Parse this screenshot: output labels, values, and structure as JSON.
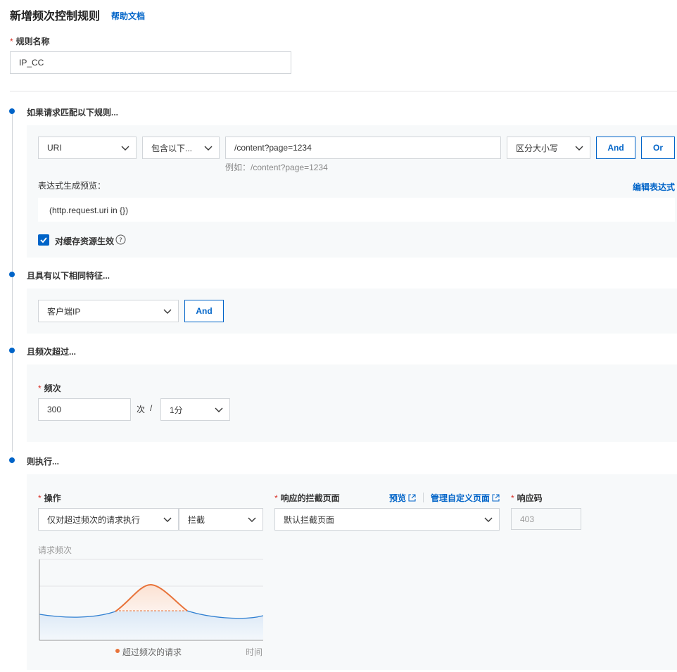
{
  "header": {
    "title": "新增频次控制规则",
    "help_link": "帮助文档"
  },
  "rule_name": {
    "label": "规则名称",
    "value": "IP_CC"
  },
  "match_section": {
    "title": "如果请求匹配以下规则...",
    "field": "URI",
    "operator": "包含以下...",
    "value": "/content?page=1234",
    "value_hint": "例如：/content?page=1234",
    "case_option": "区分大小写",
    "and_label": "And",
    "or_label": "Or",
    "expr_label": "表达式生成预览：",
    "edit_expr_label": "编辑表达式",
    "expr_value": "(http.request.uri in {})",
    "cache_checkbox_label": "对缓存资源生效",
    "cache_checked": true
  },
  "feature_section": {
    "title": "且具有以下相同特征...",
    "feature": "客户端IP",
    "and_label": "And"
  },
  "frequency_section": {
    "title": "且频次超过...",
    "label": "频次",
    "count": "300",
    "unit": "次",
    "separator": "/",
    "period": "1分"
  },
  "action_section": {
    "title": "则执行...",
    "operation_label": "操作",
    "operation_scope": "仅对超过频次的请求执行",
    "operation_action": "拦截",
    "block_page_label": "响应的拦截页面",
    "preview_link": "预览",
    "manage_link": "管理自定义页面",
    "block_page_value": "默认拦截页面",
    "code_label": "响应码",
    "code_value": "403"
  },
  "illustration": {
    "title": "请求频次",
    "legend": "超过频次的请求",
    "x_label": "时间",
    "colors": {
      "baseline": "#2f7fd1",
      "exceed": "#e8733a",
      "fill": "#dbe8f6"
    }
  },
  "colors": {
    "accent": "#0064c8",
    "required": "#d93026",
    "panel_bg": "#f7f9fa"
  }
}
